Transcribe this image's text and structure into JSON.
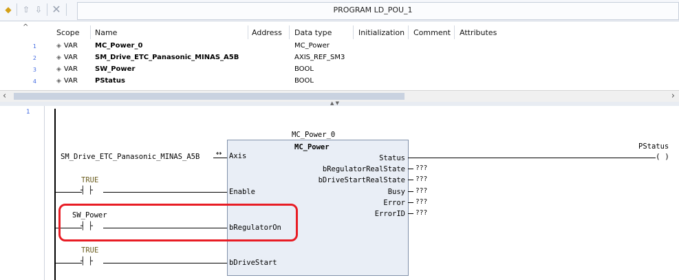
{
  "toolbar": {
    "title": "PROGRAM LD_POU_1",
    "icons": [
      "pou-icon",
      "move-up-icon",
      "move-down-icon",
      "delete-icon"
    ]
  },
  "declarations": {
    "headers": {
      "scope": "Scope",
      "name": "Name",
      "address": "Address",
      "data_type": "Data type",
      "initialization": "Initialization",
      "comment": "Comment",
      "attributes": "Attributes"
    },
    "rows": [
      {
        "num": "1",
        "scope": "VAR",
        "name": "MC_Power_0",
        "type": "MC_Power"
      },
      {
        "num": "2",
        "scope": "VAR",
        "name": "SM_Drive_ETC_Panasonic_MINAS_A5B",
        "type": "AXIS_REF_SM3"
      },
      {
        "num": "3",
        "scope": "VAR",
        "name": "SW_Power",
        "type": "BOOL"
      },
      {
        "num": "4",
        "scope": "VAR",
        "name": "PStatus",
        "type": "BOOL"
      }
    ]
  },
  "ladder": {
    "network_number": "1",
    "instance_name": "MC_Power_0",
    "fb_type": "MC_Power",
    "axis_var": "SM_Drive_ETC_Panasonic_MINAS_A5B",
    "axis_link_symbol": "↔",
    "inputs": [
      "Axis",
      "Enable",
      "bRegulatorOn",
      "bDriveStart"
    ],
    "outputs": [
      "Status",
      "bRegulatorRealState",
      "bDriveStartRealState",
      "Busy",
      "Error",
      "ErrorID"
    ],
    "unassigned": "???",
    "contact1_label": "TRUE",
    "contact2_label": "SW_Power",
    "contact3_label": "TRUE",
    "contact_symbol": "┤ ├",
    "coil_label": "PStatus",
    "coil_symbol": "( )",
    "highlight_color": "#e81c24"
  }
}
